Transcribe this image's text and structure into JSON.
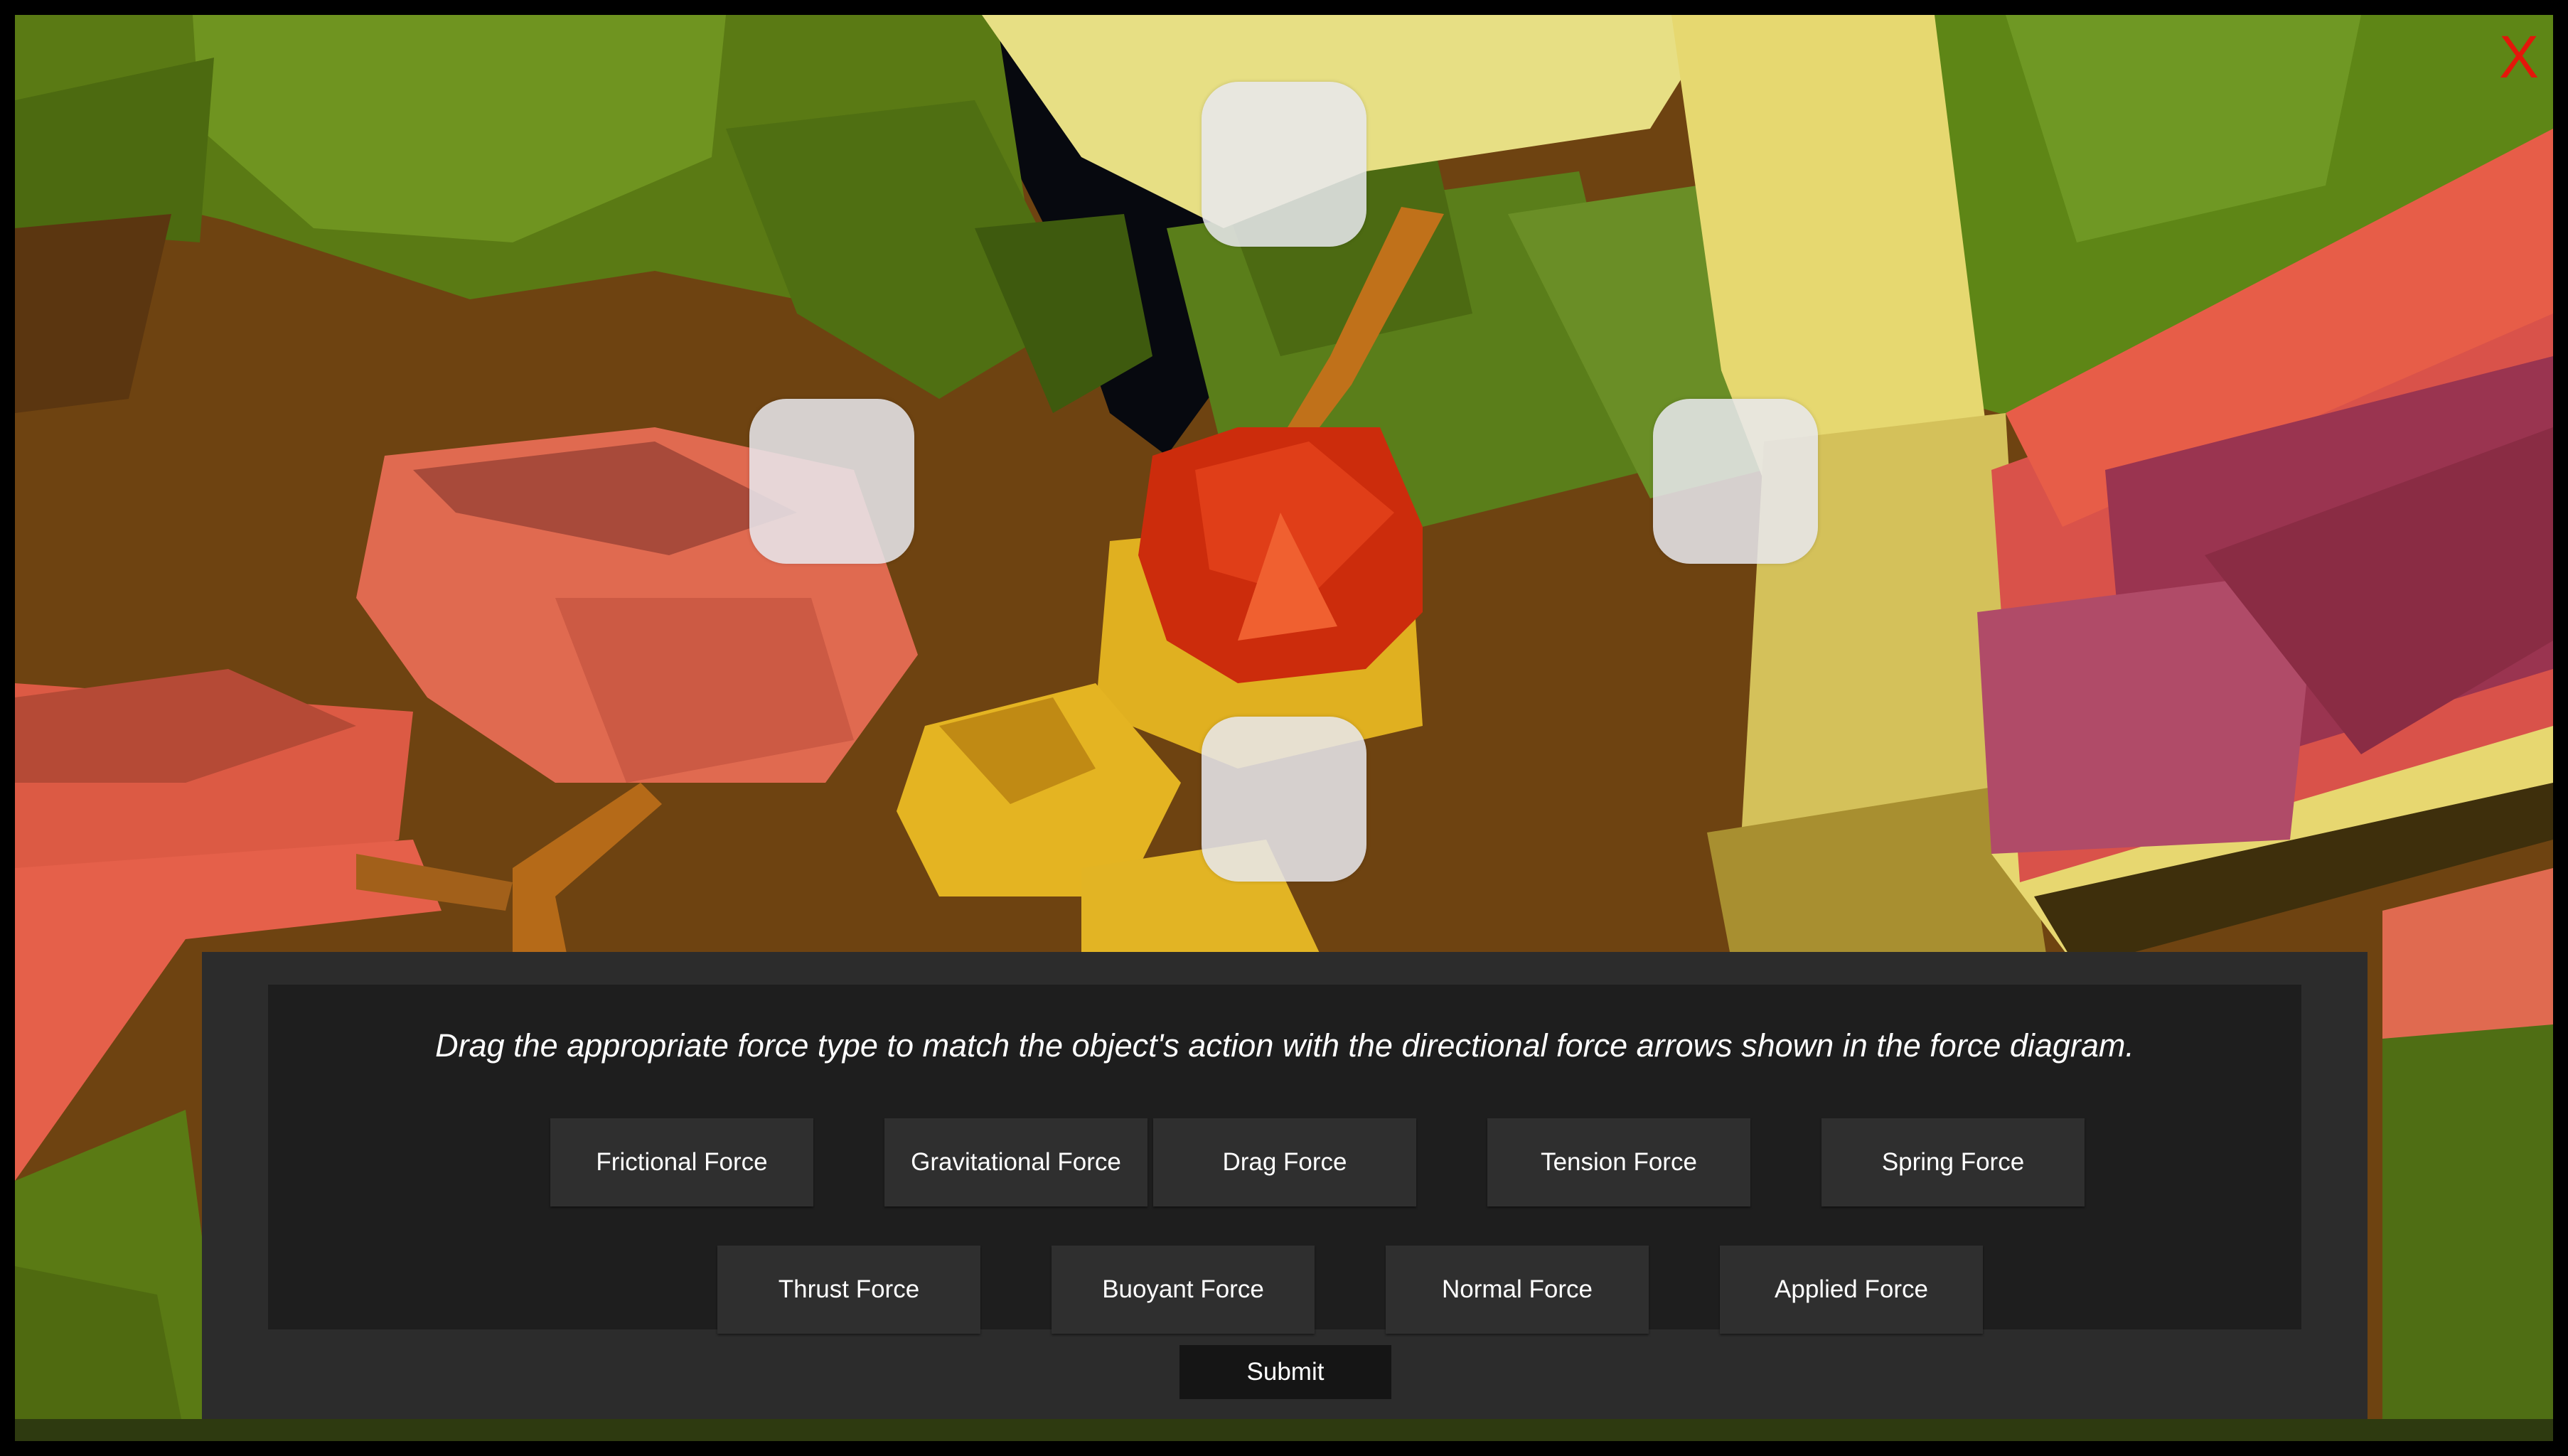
{
  "close_label": "X",
  "instruction": "Drag the appropriate force type to match the object's action with the directional force arrows shown in the force diagram.",
  "force_options": [
    "Frictional Force",
    "Gravitational Force",
    "Drag Force",
    "Tension Force",
    "Spring Force",
    "Thrust Force",
    "Buoyant Force",
    "Normal Force",
    "Applied Force"
  ],
  "submit_label": "Submit",
  "drop_slots": [
    "top",
    "left",
    "right",
    "bottom"
  ],
  "colors": {
    "close": "#e3170a",
    "panel": "#2c2c2c",
    "panel_inner": "#1e1e1e",
    "button": "#2f2f2f",
    "submit": "#151515"
  }
}
